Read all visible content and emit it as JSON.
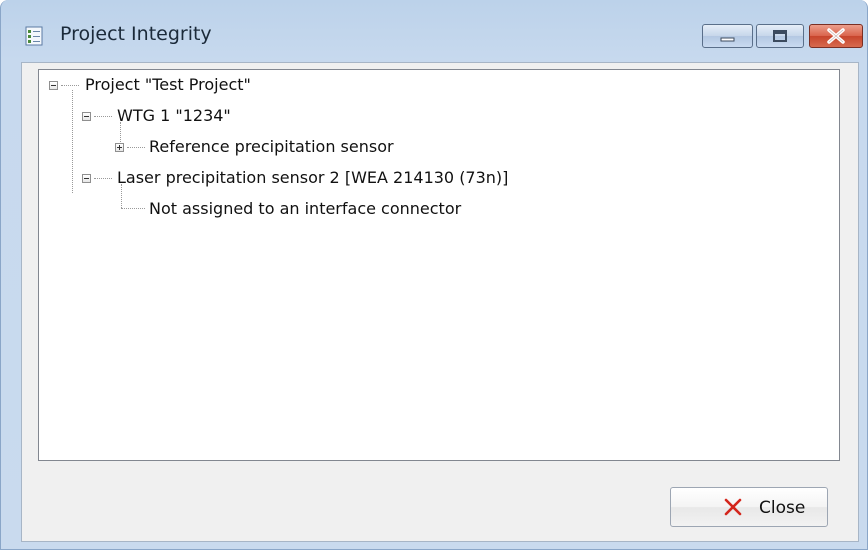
{
  "window": {
    "title": "Project Integrity",
    "icon": "checklist-icon",
    "controls": [
      "minimize-icon",
      "maximize-icon",
      "close-icon"
    ]
  },
  "tree": {
    "nodes": [
      {
        "label": "Project \"Test Project\"",
        "state": "expanded",
        "level": 0
      },
      {
        "label": "WTG 1 \"1234\"",
        "state": "expanded",
        "level": 1
      },
      {
        "label": "Reference precipitation sensor",
        "state": "collapsed",
        "level": 2
      },
      {
        "label": "Laser precipitation sensor 2 [WEA 214130 (73n)]",
        "state": "expanded",
        "level": 1
      },
      {
        "label": "Not assigned to an interface connector",
        "state": "leaf",
        "level": 2
      }
    ]
  },
  "buttons": {
    "close": {
      "label": "Close",
      "icon": "red-x-icon"
    }
  },
  "colors": {
    "close_icon": "#d4261c",
    "titlebar": "#c7d9ee",
    "window_close": "#d9644c"
  }
}
